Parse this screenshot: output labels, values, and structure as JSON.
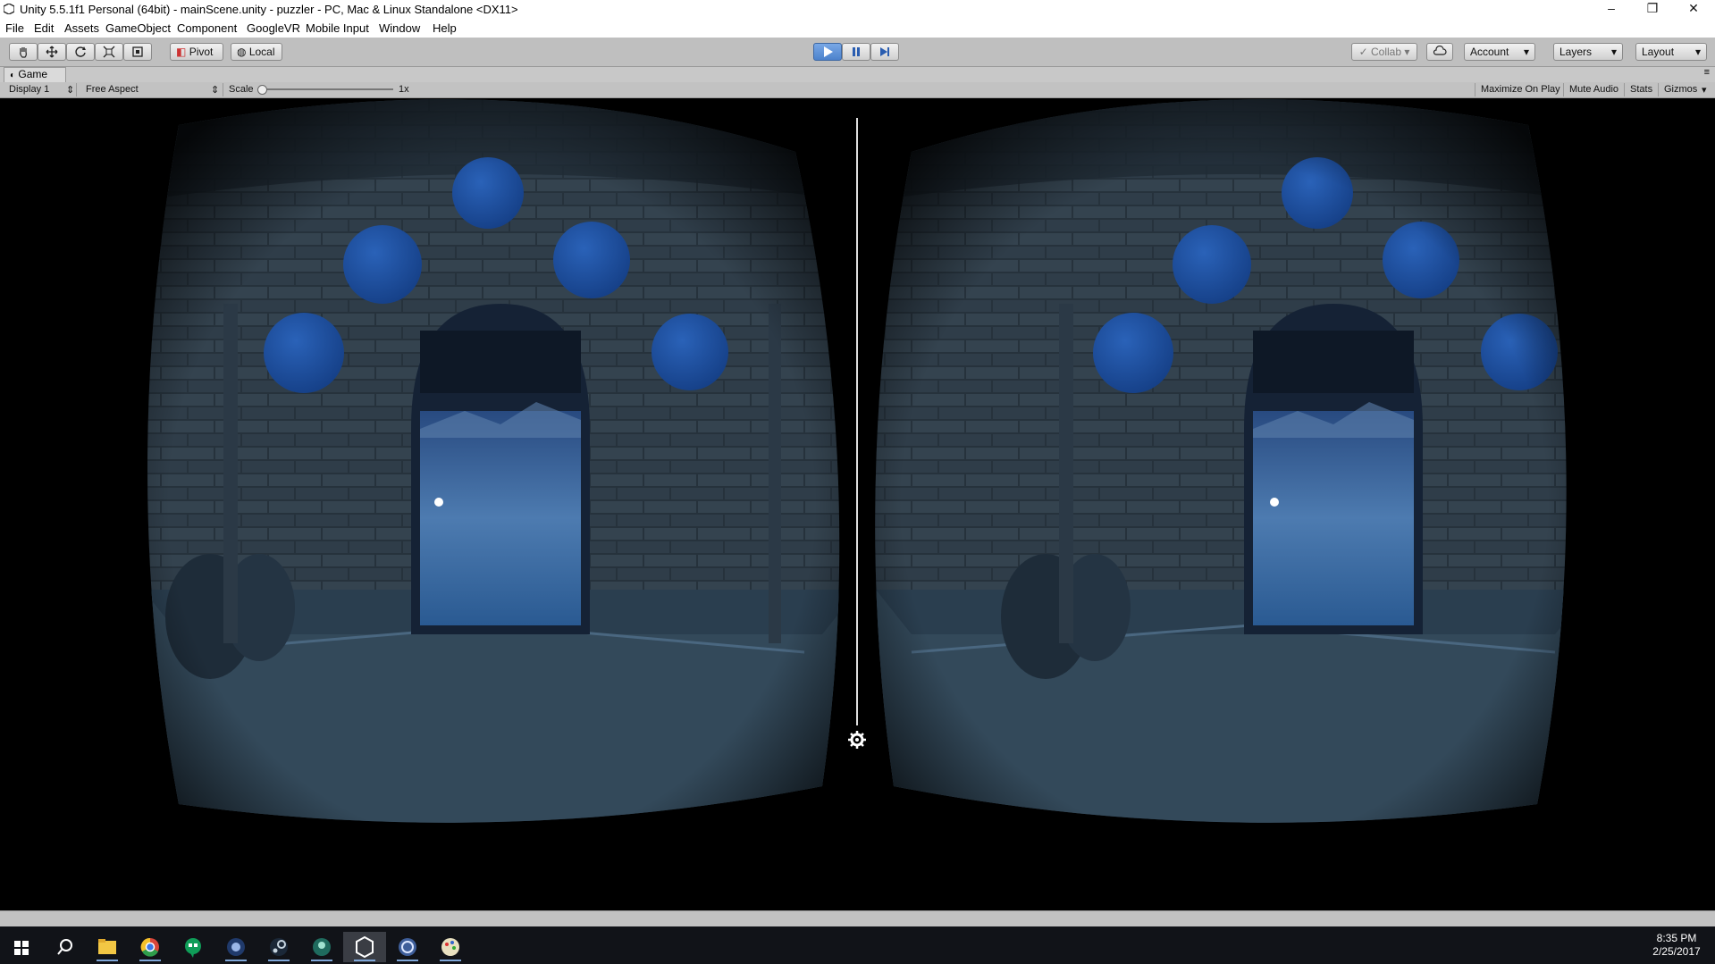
{
  "window": {
    "title": "Unity 5.5.1f1 Personal (64bit) - mainScene.unity - puzzler - PC, Mac & Linux Standalone <DX11>",
    "minimize": "–",
    "maximize": "❐",
    "close": "✕"
  },
  "menu": [
    "File",
    "Edit",
    "Assets",
    "GameObject",
    "Component",
    "GoogleVR",
    "Mobile Input",
    "Window",
    "Help"
  ],
  "toolbar": {
    "pivot": "Pivot",
    "local": "Local",
    "collab": "Collab",
    "account": "Account",
    "layers": "Layers",
    "layout": "Layout",
    "play_state": "playing"
  },
  "game_tab": {
    "label": "Game"
  },
  "game_bar": {
    "display": "Display 1",
    "aspect": "Free Aspect",
    "scale_label": "Scale",
    "scale_value": "1x",
    "maximize_on_play": "Maximize On Play",
    "mute_audio": "Mute Audio",
    "stats": "Stats",
    "gizmos": "Gizmos"
  },
  "taskbar": {
    "time": "8:35 PM",
    "date": "2/25/2017",
    "apps": [
      "windows-start",
      "search",
      "file-explorer",
      "chrome",
      "hangouts",
      "app-blue",
      "steam",
      "app-green",
      "unity",
      "app-disc",
      "app-paint"
    ]
  },
  "colors": {
    "toolbar": "#bfbfbf",
    "accent_play": "#4c82cc",
    "orb": "#1d4f9f",
    "stone": "#2a3a48"
  }
}
